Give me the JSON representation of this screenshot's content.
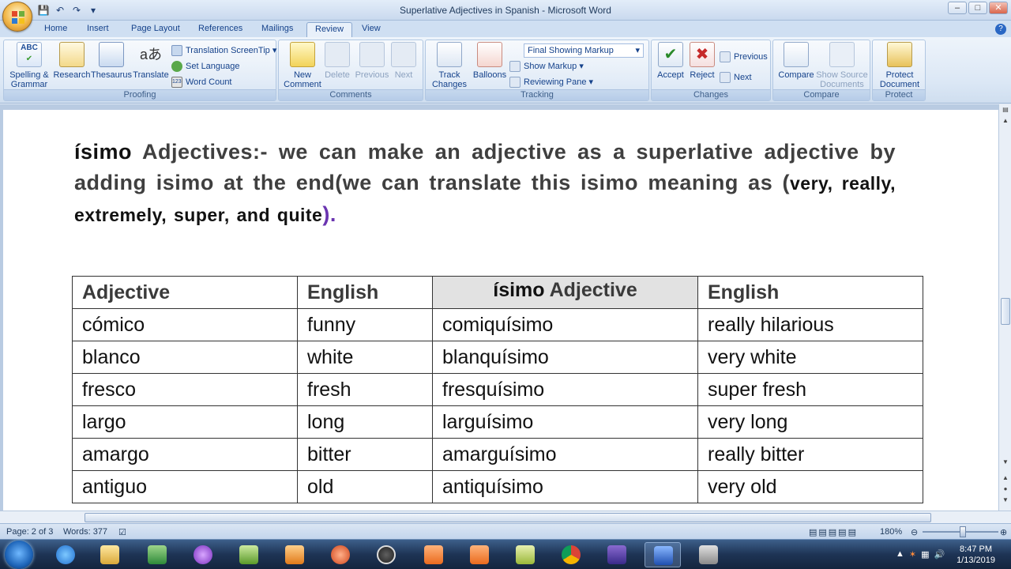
{
  "window": {
    "title": "Superlative Adjectives in Spanish - Microsoft Word",
    "controls": [
      "–",
      "□",
      "✕"
    ]
  },
  "tabs": [
    "Home",
    "Insert",
    "Page Layout",
    "References",
    "Mailings",
    "Review",
    "View"
  ],
  "active_tab": "Review",
  "ribbon": {
    "proofing": {
      "label": "Proofing",
      "spelling": "Spelling &",
      "spelling2": "Grammar",
      "research": "Research",
      "thesaurus": "Thesaurus",
      "translate": "Translate",
      "translation_screentip": "Translation ScreenTip",
      "set_language": "Set Language",
      "word_count": "Word Count"
    },
    "comments": {
      "label": "Comments",
      "new": "New",
      "new2": "Comment",
      "delete": "Delete",
      "previous": "Previous",
      "next": "Next"
    },
    "tracking": {
      "label": "Tracking",
      "track": "Track",
      "track2": "Changes",
      "balloons": "Balloons",
      "final_markup": "Final Showing Markup",
      "show_markup": "Show Markup",
      "reviewing_pane": "Reviewing Pane"
    },
    "changes": {
      "label": "Changes",
      "accept": "Accept",
      "reject": "Reject",
      "previous": "Previous",
      "next": "Next"
    },
    "compare": {
      "label": "Compare",
      "compare": "Compare",
      "show_source": "Show Source",
      "show_source2": "Documents"
    },
    "protect": {
      "label": "Protect",
      "protect": "Protect",
      "protect2": "Document"
    }
  },
  "document": {
    "para_word1": "ísimo",
    "para_main": "Adjectives:- we can make an adjective as a superlative adjective by adding isimo at the end(we can translate this isimo meaning as (",
    "para_small": "very, really, extremely, super, and quite",
    "para_close": ").",
    "table": {
      "headers": [
        "Adjective",
        "English",
        "Adjective",
        "English"
      ],
      "header3_prefix": "ísimo",
      "rows": [
        [
          "cómico",
          "funny",
          "comiquísimo",
          "really hilarious"
        ],
        [
          "blanco",
          "white",
          "blanquísimo",
          "very white"
        ],
        [
          "fresco",
          "fresh",
          "fresquísimo",
          "super fresh"
        ],
        [
          "largo",
          "long",
          "larguísimo",
          "very long"
        ],
        [
          "amargo",
          "bitter",
          "amarguísimo",
          "really bitter"
        ],
        [
          "antiguo",
          "old",
          "antiquísimo",
          "very old"
        ]
      ]
    }
  },
  "status": {
    "page": "Page: 2 of 3",
    "words": "Words: 377",
    "zoom": "180%"
  },
  "clock": {
    "time": "8:47 PM",
    "date": "1/13/2019"
  }
}
